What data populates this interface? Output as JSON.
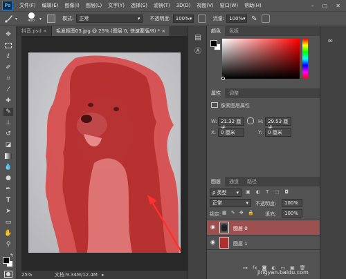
{
  "app": {
    "logo": "Ps"
  },
  "menu": [
    "文件(F)",
    "编辑(E)",
    "图像(I)",
    "图层(L)",
    "文字(Y)",
    "选择(S)",
    "滤镜(T)",
    "3D(D)",
    "视图(V)",
    "窗口(W)",
    "帮助(H)"
  ],
  "window_controls": [
    "–",
    "▢",
    "✕"
  ],
  "options": {
    "brush_size": "400",
    "mode_label": "模式:",
    "mode_value": "正常",
    "opacity_label": "不透明度:",
    "opacity_value": "100%",
    "flow_label": "流量:",
    "flow_value": "100%"
  },
  "tabs": [
    {
      "label": "抖音.psd  ×"
    },
    {
      "label": "毛发抠图03.jpg @ 25% (图层 0, 快速蒙版/8) *  ×"
    }
  ],
  "status": {
    "zoom": "25%",
    "doc": "文档:9.34M/12.4M"
  },
  "color_panel": {
    "tabs": [
      "颜色",
      "色板"
    ]
  },
  "properties_panel": {
    "tabs": [
      "属性",
      "调整"
    ],
    "title": "像素图层属性",
    "w_label": "W:",
    "w_value": "21.32 厘米",
    "h_label": "H:",
    "h_value": "29.53 厘米",
    "x_label": "X:",
    "x_value": "0 厘米",
    "y_label": "Y:",
    "y_value": "0 厘米",
    "link_icon": "link-icon"
  },
  "layers_panel": {
    "tabs": [
      "图层",
      "通道",
      "路径"
    ],
    "filter_label": "ρ 类型",
    "blend_mode": "正常",
    "opacity_label": "不透明度:",
    "opacity_value": "100%",
    "lock_label": "锁定:",
    "fill_label": "填充:",
    "fill_value": "100%",
    "layers": [
      {
        "name": "图层 0",
        "selected": true
      },
      {
        "name": "图层 1",
        "selected": false
      }
    ],
    "footer_icons": [
      "link",
      "fx",
      "mask",
      "adjust",
      "folder",
      "new",
      "trash"
    ]
  },
  "watermark": "jingyan.baidu.com",
  "colors": {
    "mask_red": "#d23a3a",
    "selected_layer": "#9c5050",
    "layer1_swatch": "#b03030"
  }
}
